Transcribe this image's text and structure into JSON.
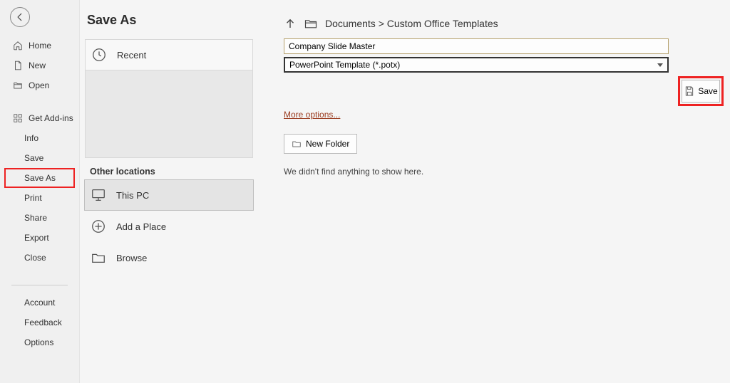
{
  "page_title": "Save As",
  "sidebar": {
    "home": "Home",
    "new": "New",
    "open": "Open",
    "get_addins": "Get Add-ins",
    "info": "Info",
    "save": "Save",
    "save_as": "Save As",
    "print": "Print",
    "share": "Share",
    "export": "Export",
    "close": "Close",
    "account": "Account",
    "feedback": "Feedback",
    "options": "Options"
  },
  "middle": {
    "recent": "Recent",
    "other_locations": "Other locations",
    "this_pc": "This PC",
    "add_place": "Add a Place",
    "browse": "Browse"
  },
  "main": {
    "breadcrumb": "Documents > Custom Office Templates",
    "filename": "Company Slide Master",
    "filetype": "PowerPoint Template (*.potx)",
    "save_button": "Save",
    "more_options": "More options...",
    "new_folder": "New Folder",
    "empty_message": "We didn't find anything to show here."
  }
}
